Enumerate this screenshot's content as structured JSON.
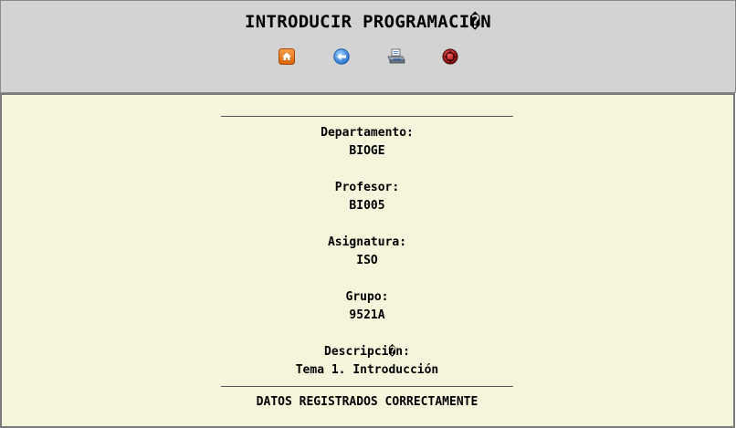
{
  "header": {
    "title": "INTRODUCIR PROGRAMACI�N",
    "icons": [
      "home-icon",
      "back-icon",
      "print-icon",
      "exit-icon"
    ]
  },
  "record": {
    "departamento_label": "Departamento:",
    "departamento_value": "BIOGE",
    "profesor_label": "Profesor:",
    "profesor_value": "BI005",
    "asignatura_label": "Asignatura:",
    "asignatura_value": "ISO",
    "grupo_label": "Grupo:",
    "grupo_value": "9521A",
    "descripcion_label": "Descripci�n:",
    "descripcion_value": "Tema 1. Introducción"
  },
  "status": {
    "message": "DATOS REGISTRADOS CORRECTAMENTE"
  },
  "colors": {
    "header_bg": "#d3d3d3",
    "body_bg": "#f5f5dc",
    "home_icon": "#e8730c",
    "back_icon": "#2f7fd8",
    "exit_icon": "#b01010"
  }
}
